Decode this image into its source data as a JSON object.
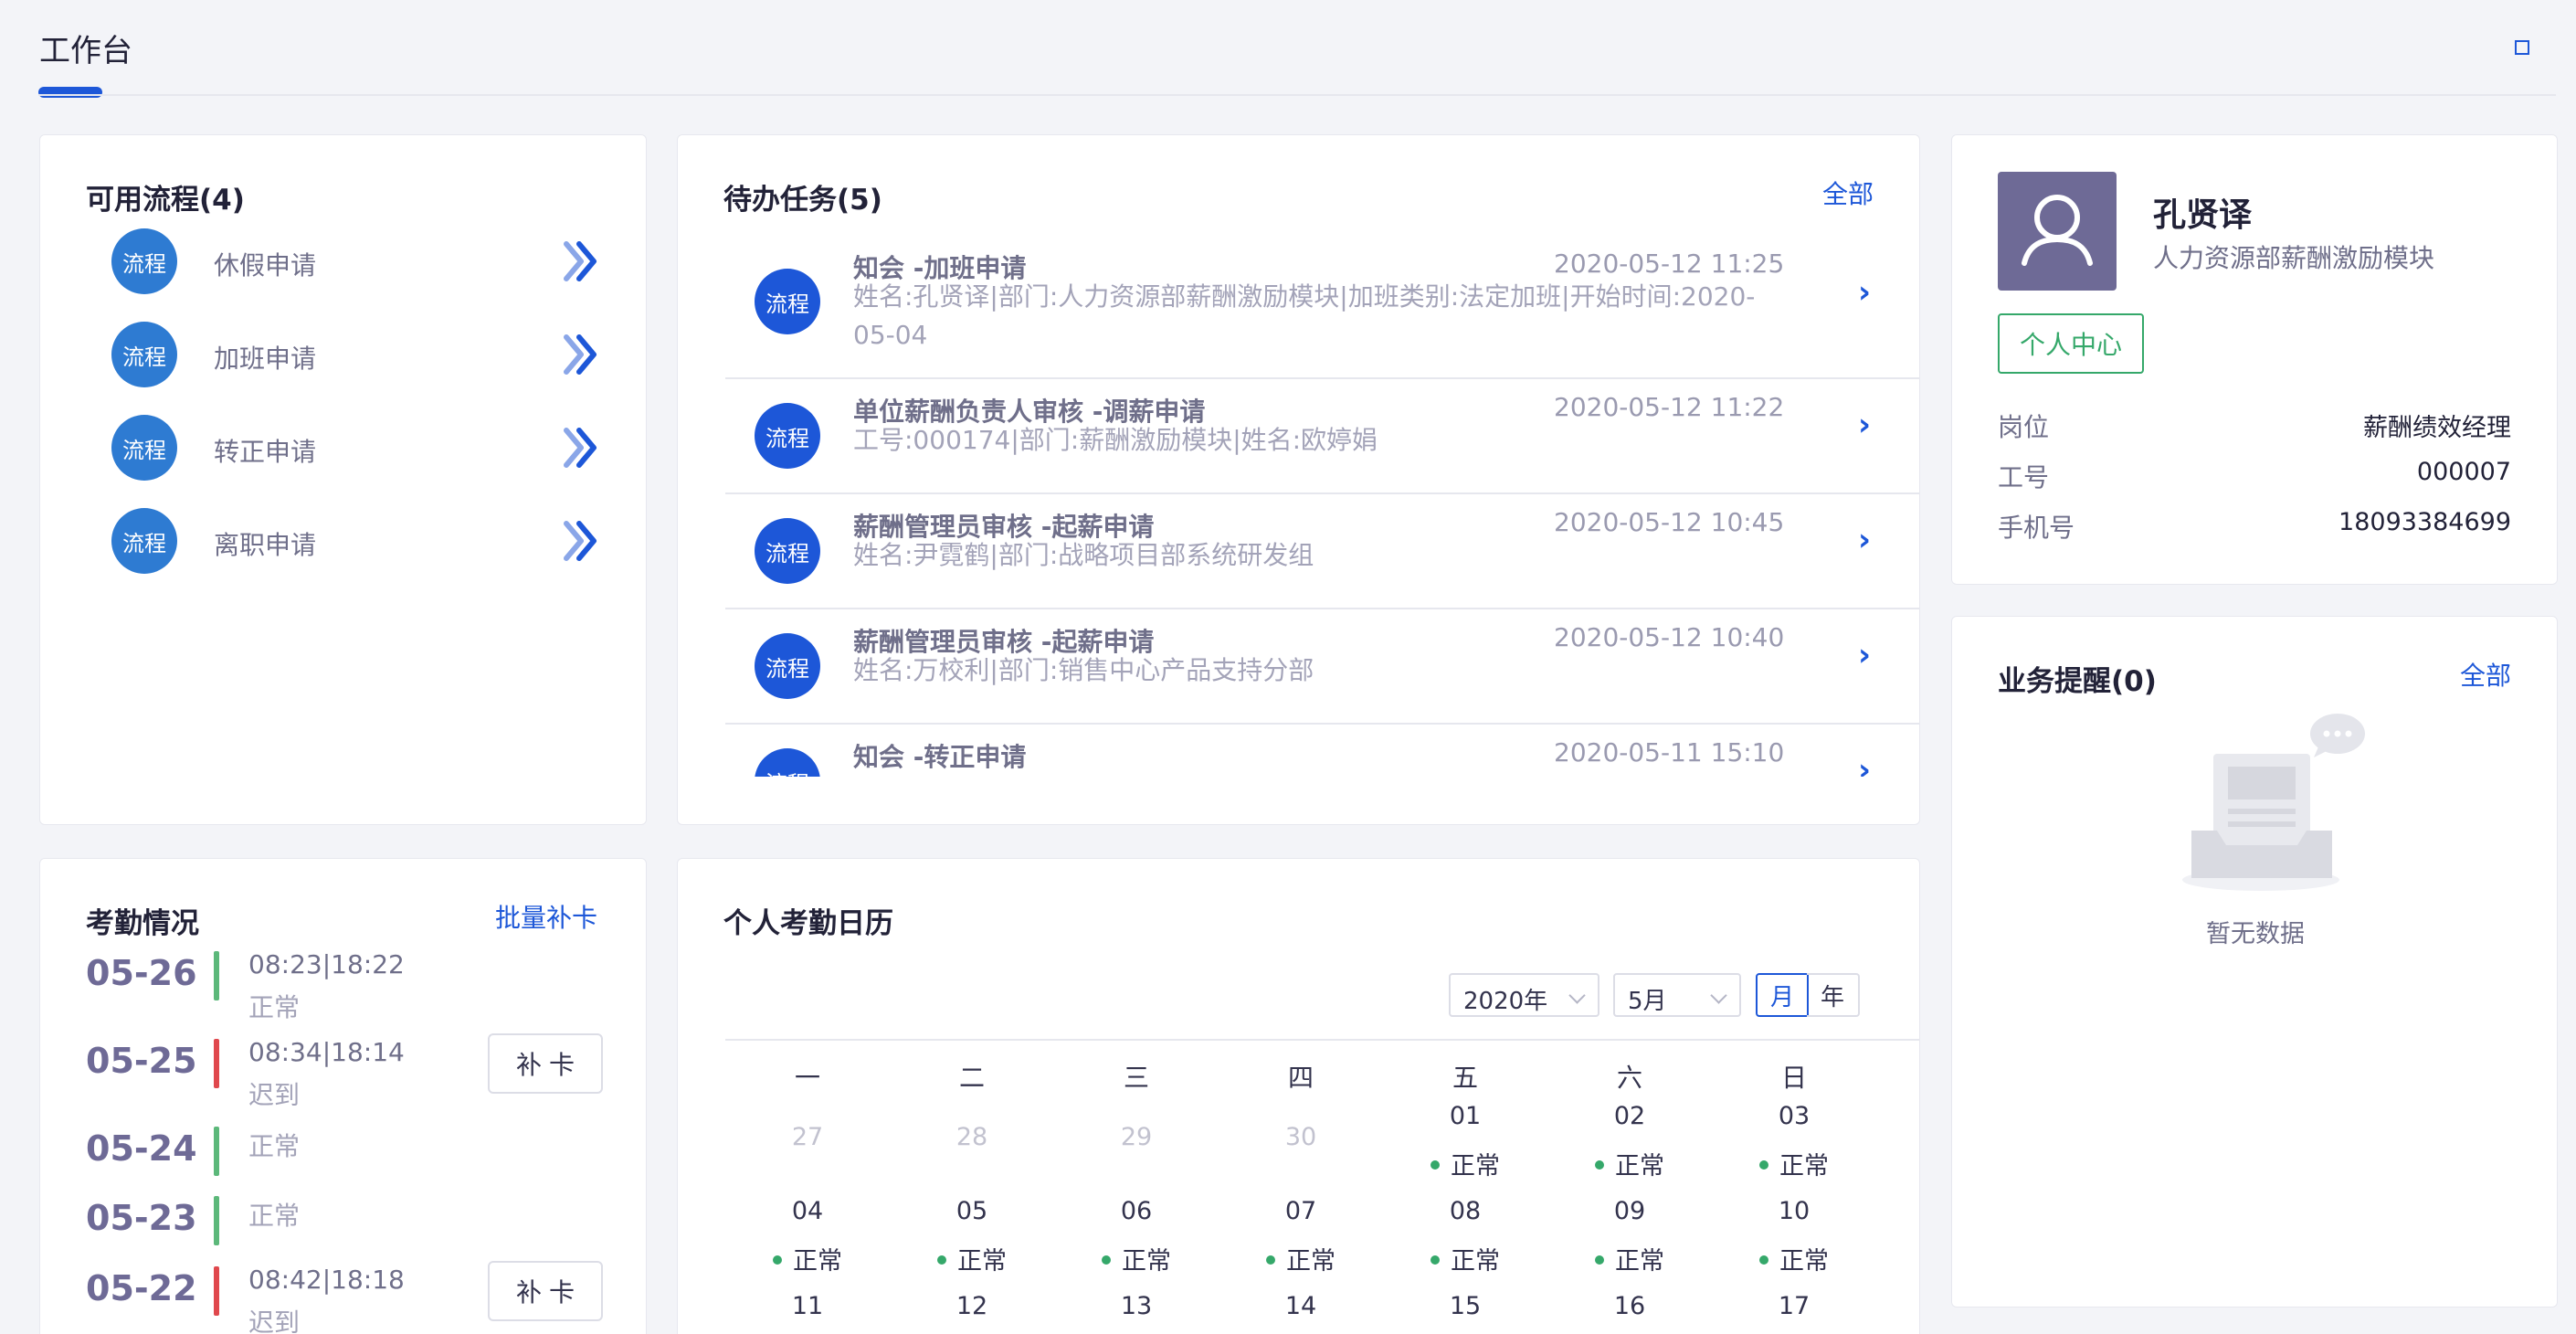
{
  "header": {
    "title": "工作台"
  },
  "processes": {
    "title": "可用流程(4)",
    "badge": "流程",
    "items": [
      {
        "label": "休假申请"
      },
      {
        "label": "加班申请"
      },
      {
        "label": "转正申请"
      },
      {
        "label": "离职申请"
      }
    ]
  },
  "todo": {
    "title": "待办任务(5)",
    "all_link": "全部",
    "badge": "流程",
    "items": [
      {
        "title": "知会 -加班申请",
        "time": "2020-05-12 11:25",
        "desc": "姓名:孔贤译|部门:人力资源部薪酬激励模块|加班类别:法定加班|开始时间:2020-05-04"
      },
      {
        "title": "单位薪酬负责人审核 -调薪申请",
        "time": "2020-05-12 11:22",
        "desc": "工号:000174|部门:薪酬激励模块|姓名:欧婷娟"
      },
      {
        "title": "薪酬管理员审核 -起薪申请",
        "time": "2020-05-12 10:45",
        "desc": "姓名:尹霓鹤|部门:战略项目部系统研发组"
      },
      {
        "title": "薪酬管理员审核 -起薪申请",
        "time": "2020-05-12 10:40",
        "desc": "姓名:万校利|部门:销售中心产品支持分部"
      },
      {
        "title": "知会 -转正申请",
        "time": "2020-05-11 15:10",
        "desc": ""
      }
    ]
  },
  "user": {
    "name": "孔贤译",
    "dept": "人力资源部薪酬激励模块",
    "center_button": "个人中心",
    "fields": [
      {
        "label": "岗位",
        "value": "薪酬绩效经理"
      },
      {
        "label": "工号",
        "value": "000007"
      },
      {
        "label": "手机号",
        "value": "18093384699"
      }
    ]
  },
  "attendance": {
    "title": "考勤情况",
    "batch_link": "批量补卡",
    "fix_label": "补卡",
    "records": [
      {
        "date": "05-26",
        "times": "08:23|18:22",
        "status": "正常",
        "color": "#5cb87a"
      },
      {
        "date": "05-25",
        "times": "08:34|18:14",
        "status": "迟到",
        "color": "#e0484d"
      },
      {
        "date": "05-24",
        "times": "",
        "status": "正常",
        "color": "#5cb87a"
      },
      {
        "date": "05-23",
        "times": "",
        "status": "正常",
        "color": "#5cb87a"
      },
      {
        "date": "05-22",
        "times": "08:42|18:18",
        "status": "迟到",
        "color": "#e0484d"
      }
    ]
  },
  "calendar": {
    "title": "个人考勤日历",
    "year": "2020年",
    "month": "5月",
    "mode_month": "月",
    "mode_year": "年",
    "weekdays": [
      "一",
      "二",
      "三",
      "四",
      "五",
      "六",
      "日"
    ],
    "status_label": "正常",
    "status_color": "#35a86a",
    "weeks": [
      [
        "27",
        "28",
        "29",
        "30",
        "01",
        "02",
        "03"
      ],
      [
        "04",
        "05",
        "06",
        "07",
        "08",
        "09",
        "10"
      ],
      [
        "11",
        "12",
        "13",
        "14",
        "15",
        "16",
        "17"
      ]
    ]
  },
  "reminders": {
    "title": "业务提醒(0)",
    "all_link": "全部",
    "empty_text": "暂无数据"
  },
  "colors": {
    "accent": "#1d57d8",
    "success": "#35a86a",
    "danger": "#e0484d",
    "avatar_bg": "#6e6a96"
  }
}
